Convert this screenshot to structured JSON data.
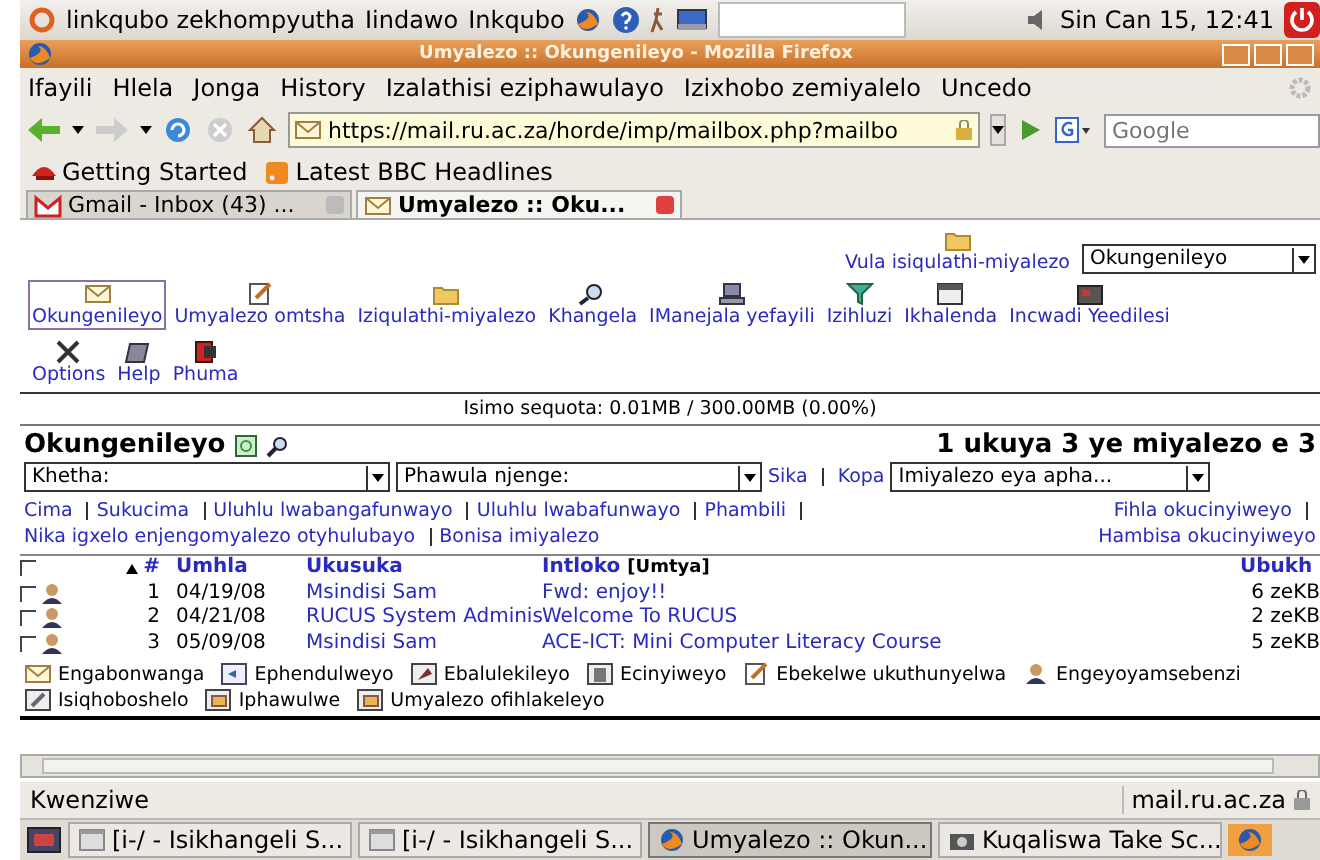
{
  "top_panel": {
    "menus": [
      "linkqubo zekhompyutha",
      "Iindawo",
      "Inkqubo"
    ],
    "clock": "Sin Can 15, 12:41"
  },
  "window": {
    "title": "Umyalezo :: Okungenileyo - Mozilla Firefox"
  },
  "menu_bar": [
    "Ifayili",
    "Hlela",
    "Jonga",
    "History",
    "Izalathisi eziphawulayo",
    "Izixhobo zemiyalelo",
    "Uncedo"
  ],
  "address": {
    "url": "https://mail.ru.ac.za/horde/imp/mailbox.php?mailbo"
  },
  "search": {
    "placeholder": "Google"
  },
  "bookmarks": [
    {
      "label": "Getting Started",
      "kind": "hat"
    },
    {
      "label": "Latest BBC Headlines",
      "kind": "feed"
    }
  ],
  "tabs": [
    {
      "label": "Gmail - Inbox (43) ...",
      "kind": "gmail",
      "selected": false
    },
    {
      "label": "Umyalezo :: Oku...",
      "kind": "envelope",
      "selected": true
    }
  ],
  "mail": {
    "open_folder": "Vula isiqulathi-miyalezo",
    "folder_select": "Okungenileyo",
    "nav": [
      {
        "label": "Okungenileyo",
        "kind": "envelope",
        "selected": true
      },
      {
        "label": "Umyalezo omtsha",
        "kind": "compose",
        "selected": false
      },
      {
        "label": "Iziqulathi-miyalezo",
        "kind": "folder",
        "selected": false
      },
      {
        "label": "Khangela",
        "kind": "search",
        "selected": false
      },
      {
        "label": "IManejala yefayili",
        "kind": "computer",
        "selected": false
      },
      {
        "label": "Izihluzi",
        "kind": "filter",
        "selected": false
      },
      {
        "label": "Ikhalenda",
        "kind": "calendar",
        "selected": false
      },
      {
        "label": "Incwadi Yeedilesi",
        "kind": "book",
        "selected": false
      },
      {
        "label": "Options",
        "kind": "tools",
        "selected": false
      },
      {
        "label": "Help",
        "kind": "notebook",
        "selected": false
      },
      {
        "label": "Phuma",
        "kind": "exit",
        "selected": false
      }
    ],
    "quota": "Isimo sequota: 0.01MB / 300.00MB (0.00%)",
    "heading": "Okungenileyo",
    "count": "1 ukuya 3 ye miyalezo e 3",
    "select_action": "Khetha:",
    "mark_as": "Phawula njenge:",
    "move_links": [
      "Sika",
      "Kopa"
    ],
    "target_folder": "Imiyalezo eya apha...",
    "actions": [
      "Cima",
      "Sukucima",
      "Uluhlu lwabangafunwayo",
      "Uluhlu lwabafunwayo",
      "Phambili",
      "Nika igxelo enjengomyalezo otyhulubayo",
      "Bonisa imiyalezo"
    ],
    "view_actions": [
      "Fihla okucinyiweyo",
      "Hambisa okucinyiweyo"
    ],
    "select_all": {
      "checked": false
    },
    "columns": [
      "#",
      "Umhla",
      "Ukusuka",
      "Intloko",
      "Ubukh"
    ],
    "subject_toggle": "[Umtya]",
    "rows": [
      {
        "num": "1",
        "date": "04/19/08",
        "from": "Msindisi Sam",
        "subject": "Fwd: enjoy!!",
        "size": "6 zeKB",
        "checked": false
      },
      {
        "num": "2",
        "date": "04/21/08",
        "from": "RUCUS System Adminis",
        "subject": "Welcome To RUCUS",
        "size": "2 zeKB",
        "checked": false
      },
      {
        "num": "3",
        "date": "05/09/08",
        "from": "Msindisi Sam",
        "subject": "ACE-ICT: Mini Computer Literacy Course",
        "size": "5 zeKB",
        "checked": false
      }
    ],
    "legend": [
      {
        "label": "Engabonwanga",
        "kind": "envelope"
      },
      {
        "label": "Ephendulweyo",
        "kind": "reply"
      },
      {
        "label": "Ebalulekileyo",
        "kind": "flag"
      },
      {
        "label": "Ecinyiweyo",
        "kind": "trash"
      },
      {
        "label": "Ebekelwe ukuthunyelwa",
        "kind": "compose"
      },
      {
        "label": "Engeyoyamsebenzi",
        "kind": "person"
      },
      {
        "label": "Isiqhoboshelo",
        "kind": "paperclip"
      },
      {
        "label": "Iphawulwe",
        "kind": "note"
      },
      {
        "label": "Umyalezo ofihlakeleyo",
        "kind": "note"
      }
    ]
  },
  "status_bar": {
    "text": "Kwenziwe",
    "host": "mail.ru.ac.za"
  },
  "taskbar": [
    {
      "label": "[i-/ - Isikhangeli S...",
      "kind": "window",
      "selected": false
    },
    {
      "label": "[i-/ - Isikhangeli S...",
      "kind": "window",
      "selected": false
    },
    {
      "label": "Umyalezo :: Okun...",
      "kind": "firefox",
      "selected": true
    },
    {
      "label": "Kuqaliswa Take Sc...",
      "kind": "camera",
      "selected": false
    }
  ]
}
